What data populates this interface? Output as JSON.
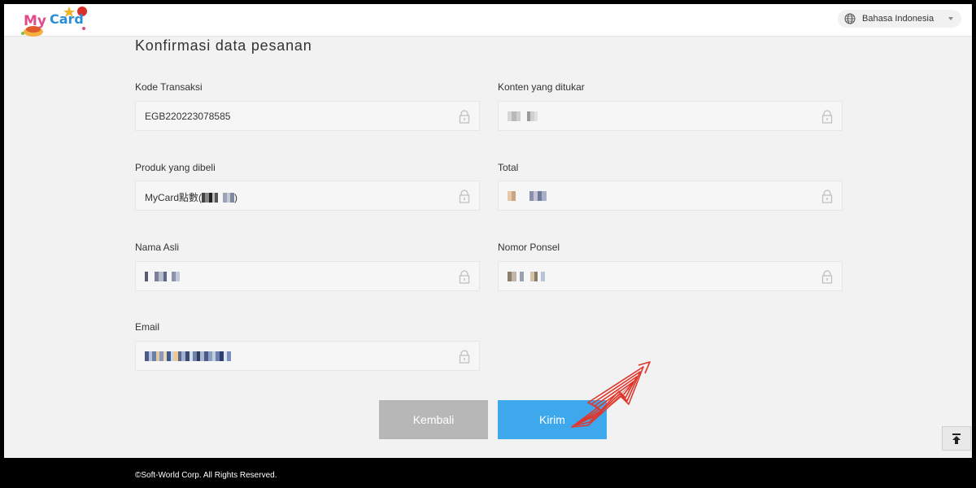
{
  "header": {
    "logo_text": "MyCard",
    "language": "Bahasa Indonesia"
  },
  "page": {
    "title": "Konfirmasi data pesanan"
  },
  "form": {
    "kode_transaksi": {
      "label": "Kode Transaksi",
      "value": "EGB220223078585"
    },
    "konten": {
      "label": "Konten yang ditukar"
    },
    "produk": {
      "label": "Produk yang dibeli",
      "value_prefix": "MyCard點數(",
      "value_suffix": ")"
    },
    "total": {
      "label": "Total"
    },
    "nama": {
      "label": "Nama Asli"
    },
    "ponsel": {
      "label": "Nomor Ponsel"
    },
    "email": {
      "label": "Email"
    }
  },
  "buttons": {
    "back": "Kembali",
    "submit": "Kirim"
  },
  "footer": {
    "copyright": "©Soft-World Corp. All Rights Reserved."
  },
  "colors": {
    "submit": "#3ea8ec",
    "back": "#b7b7b7",
    "annotation_arrow": "#e0362b"
  }
}
